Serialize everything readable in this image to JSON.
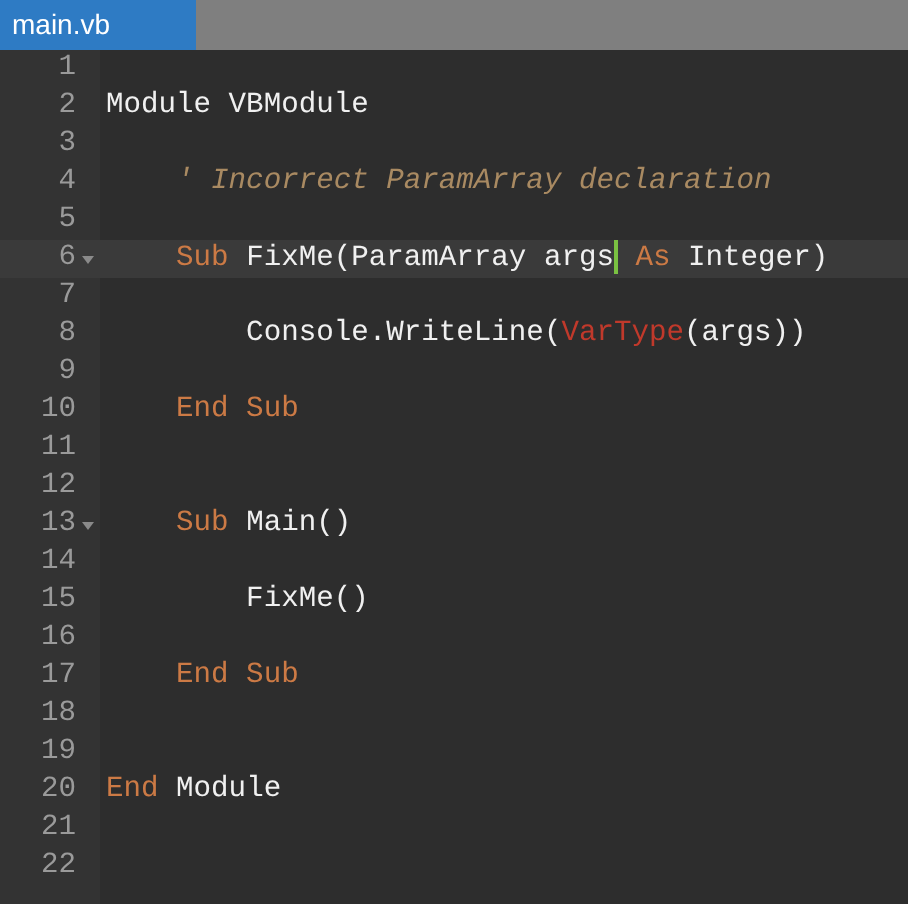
{
  "tabs": [
    {
      "label": "main.vb",
      "selected": true
    }
  ],
  "lines": [
    {
      "number": "1",
      "fold": false,
      "active": false
    },
    {
      "number": "2",
      "fold": false,
      "active": false,
      "tokens": [
        {
          "kind": "keyword-plain",
          "text": "Module VBModule"
        }
      ]
    },
    {
      "number": "3",
      "fold": false,
      "active": false
    },
    {
      "number": "4",
      "fold": false,
      "active": false,
      "tokens": [
        {
          "kind": "comment",
          "text": "    ' Incorrect ParamArray declaration"
        }
      ]
    },
    {
      "number": "5",
      "fold": false,
      "active": false
    },
    {
      "number": "6",
      "fold": true,
      "active": true,
      "tokens": [
        {
          "kind": "keyword",
          "text": "    Sub"
        },
        {
          "kind": "plain",
          "text": " FixMe(ParamArray args"
        },
        {
          "kind": "cursor"
        },
        {
          "kind": "keyword",
          "text": " As"
        },
        {
          "kind": "plain",
          "text": " Integer)"
        }
      ]
    },
    {
      "number": "7",
      "fold": false,
      "active": false
    },
    {
      "number": "8",
      "fold": false,
      "active": false,
      "tokens": [
        {
          "kind": "plain",
          "text": "        Console.WriteLine("
        },
        {
          "kind": "builtin",
          "text": "VarType"
        },
        {
          "kind": "plain",
          "text": "(args))"
        }
      ]
    },
    {
      "number": "9",
      "fold": false,
      "active": false
    },
    {
      "number": "10",
      "fold": false,
      "active": false,
      "tokens": [
        {
          "kind": "keyword",
          "text": "    End Sub"
        }
      ]
    },
    {
      "number": "11",
      "fold": false,
      "active": false
    },
    {
      "number": "12",
      "fold": false,
      "active": false
    },
    {
      "number": "13",
      "fold": true,
      "active": false,
      "tokens": [
        {
          "kind": "keyword",
          "text": "    Sub"
        },
        {
          "kind": "plain",
          "text": " Main()"
        }
      ]
    },
    {
      "number": "14",
      "fold": false,
      "active": false
    },
    {
      "number": "15",
      "fold": false,
      "active": false,
      "tokens": [
        {
          "kind": "plain",
          "text": "        FixMe()"
        }
      ]
    },
    {
      "number": "16",
      "fold": false,
      "active": false
    },
    {
      "number": "17",
      "fold": false,
      "active": false,
      "tokens": [
        {
          "kind": "keyword",
          "text": "    End Sub"
        }
      ]
    },
    {
      "number": "18",
      "fold": false,
      "active": false
    },
    {
      "number": "19",
      "fold": false,
      "active": false
    },
    {
      "number": "20",
      "fold": false,
      "active": false,
      "tokens": [
        {
          "kind": "keyword",
          "text": "End"
        },
        {
          "kind": "plain",
          "text": " Module"
        }
      ]
    },
    {
      "number": "21",
      "fold": false,
      "active": false
    },
    {
      "number": "22",
      "fold": false,
      "active": false
    }
  ]
}
